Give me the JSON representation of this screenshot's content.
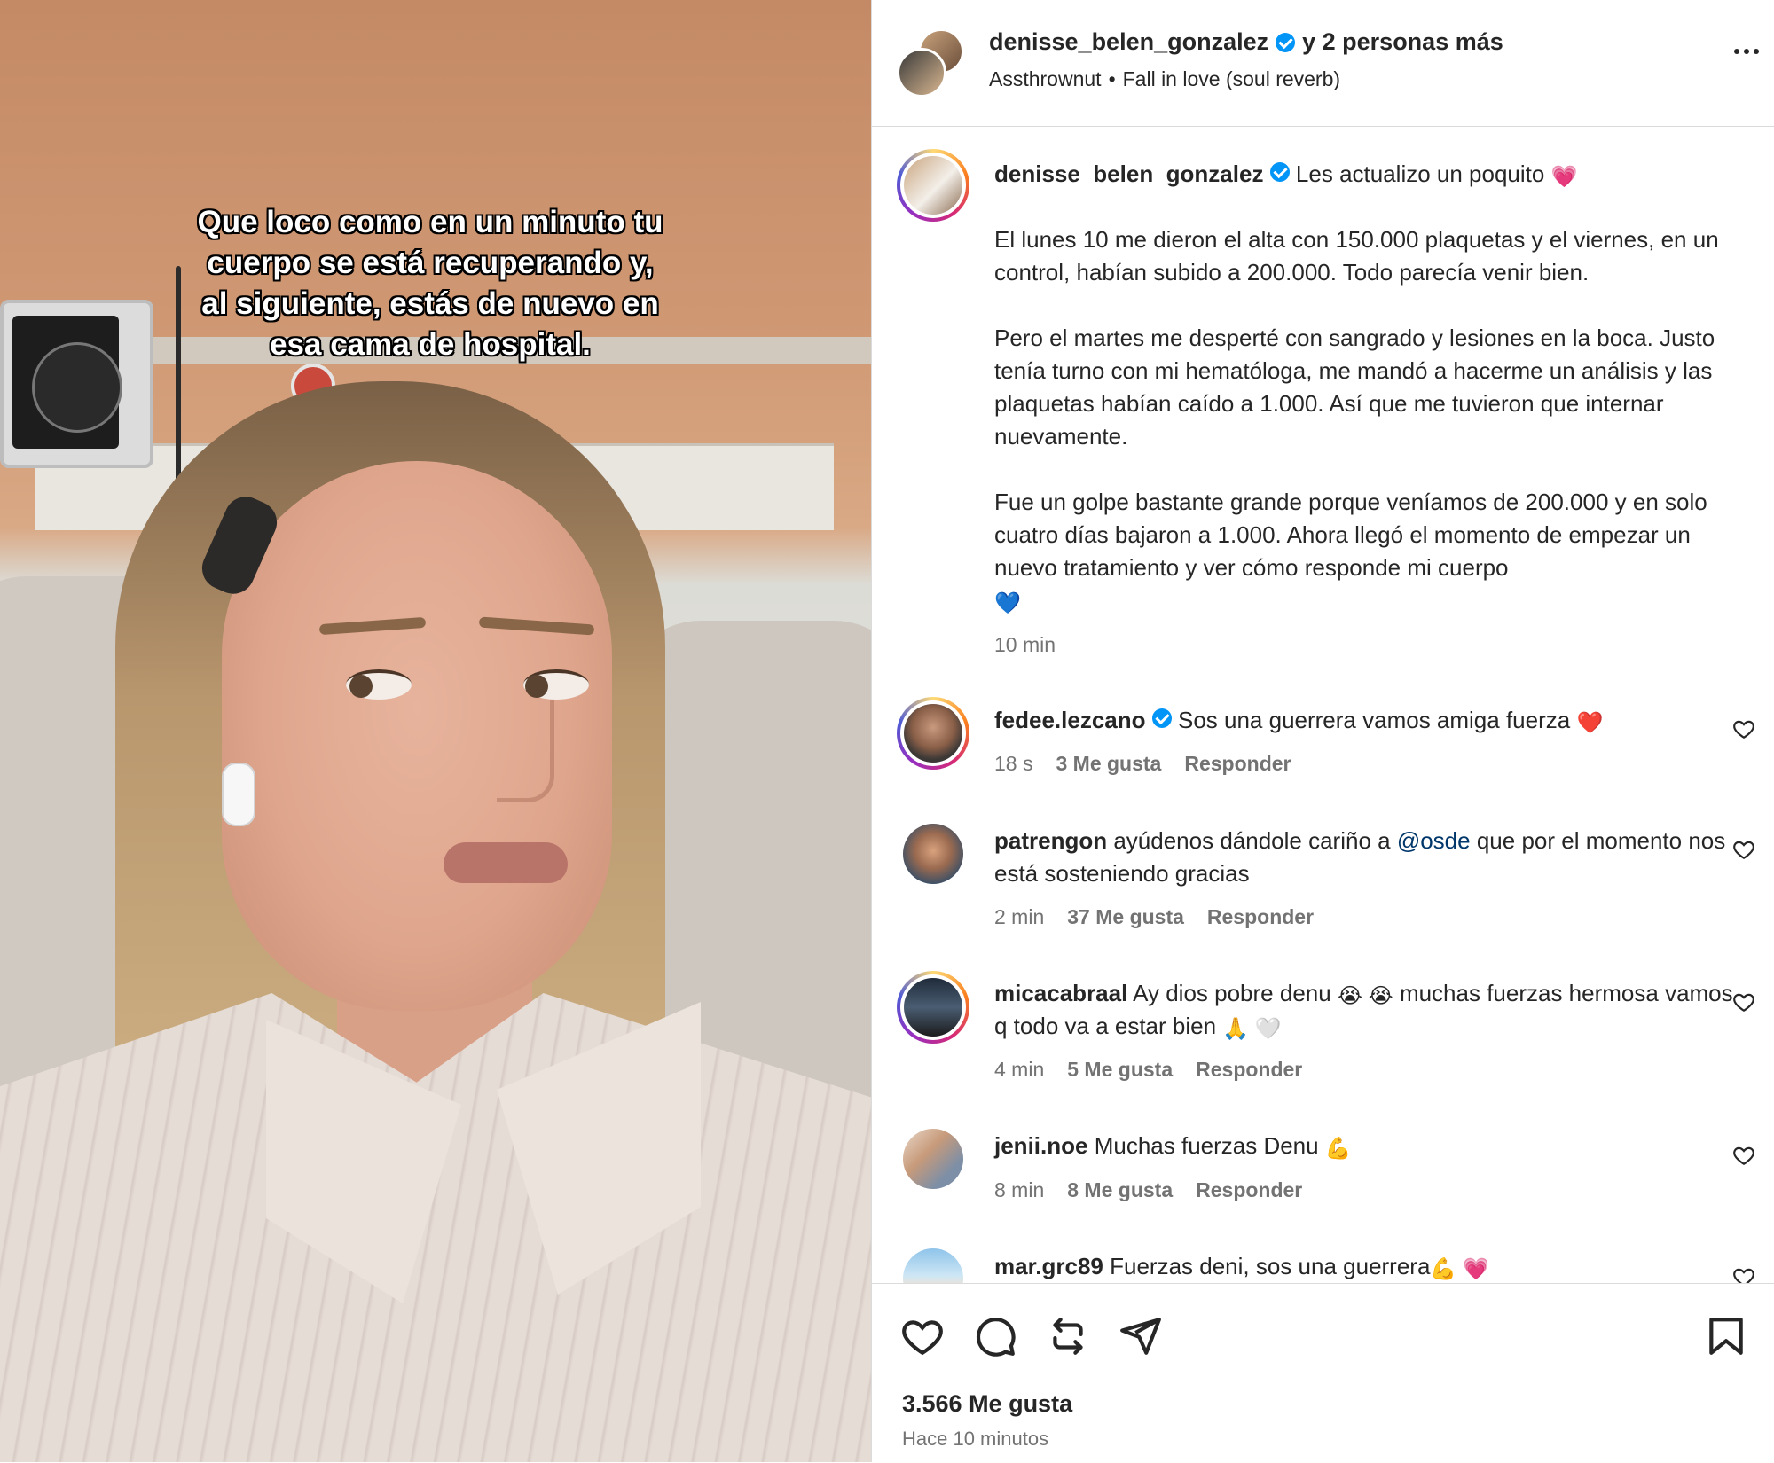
{
  "media": {
    "caption": "Que loco como en un minuto tu\ncuerpo se está recuperando y,\nal siguiente, estás de nuevo en\nesa cama de hospital."
  },
  "header": {
    "username": "denisse_belen_gonzalez",
    "collab_text": "y 2 personas más",
    "audio_artist": "Assthrownut",
    "audio_track": "Fall in love (soul reverb)"
  },
  "caption": {
    "username": "denisse_belen_gonzalez",
    "first_line": "Les actualizo un poquito",
    "first_line_emoji": "💗",
    "paragraphs": [
      "El lunes 10 me dieron el alta con 150.000 plaquetas y el viernes, en un control, habían subido a 200.000. Todo parecía venir bien.",
      "Pero el martes me desperté con sangrado y lesiones en la boca. Justo tenía turno con mi hematóloga, me mandó a hacerme un análisis y las plaquetas habían caído a 1.000. Así que me tuvieron que internar nuevamente.",
      "Fue un golpe bastante grande porque veníamos de 200.000 y en solo cuatro días bajaron a 1.000. Ahora llegó el momento de empezar un nuevo tratamiento y ver cómo responde mi cuerpo"
    ],
    "end_emoji": "💙",
    "time": "10 min"
  },
  "comments": [
    {
      "username": "fedee.lezcano",
      "verified": true,
      "text": "Sos una guerrera vamos amiga fuerza",
      "emoji": "❤️",
      "time": "18 s",
      "likes": "3 Me gusta",
      "reply": "Responder"
    },
    {
      "username": "patrengon",
      "verified": false,
      "text_before": "ayúdenos dándole cariño a",
      "mention": "@osde",
      "text_after": "que por el momento nos está sosteniendo gracias",
      "time": "2 min",
      "likes": "37 Me gusta",
      "reply": "Responder"
    },
    {
      "username": "micacabraal",
      "verified": false,
      "text_a": "Ay dios pobre denu",
      "emoji_a": "😭 😭",
      "text_b": "muchas fuerzas hermosa vamos q todo va a estar bien",
      "emoji_b": "🙏 🤍",
      "time": "4 min",
      "likes": "5 Me gusta",
      "reply": "Responder"
    },
    {
      "username": "jenii.noe",
      "verified": false,
      "text": "Muchas fuerzas Denu",
      "emoji": "💪",
      "time": "8 min",
      "likes": "8 Me gusta",
      "reply": "Responder"
    },
    {
      "username": "mar.grc89",
      "verified": false,
      "text": "Fuerzas deni, sos una guerrera",
      "emoji": "💪 💗"
    }
  ],
  "footer": {
    "likes": "3.566 Me gusta",
    "time_ago": "Hace 10 minutos"
  },
  "icons": [
    "heart-icon",
    "comment-icon",
    "repost-icon",
    "share-icon",
    "bookmark-icon",
    "more-options-icon"
  ],
  "colors": {
    "verified": "#0095f6",
    "text": "#262626",
    "muted": "#737373",
    "mention": "#00376b"
  }
}
